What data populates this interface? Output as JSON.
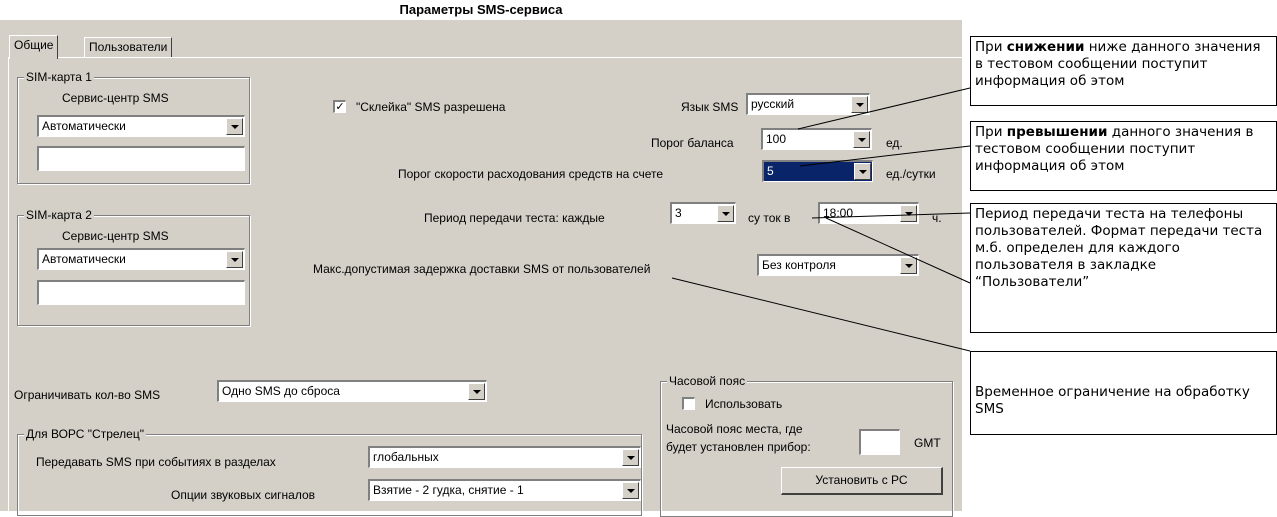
{
  "window": {
    "title": "Параметры SMS-сервиса"
  },
  "tabs": [
    {
      "label": "Общие",
      "active": true
    },
    {
      "label": "Пользователи",
      "active": false
    }
  ],
  "sim1": {
    "group_label": "SIM-карта 1",
    "center_label": "Сервис-центр SMS",
    "mode": "Автоматически",
    "number": ""
  },
  "sim2": {
    "group_label": "SIM-карта 2",
    "center_label": "Сервис-центр SMS",
    "mode": "Автоматически",
    "number": ""
  },
  "glue": {
    "label": "\"Склейка\" SMS разрешена",
    "checked": true,
    "mark": "✓"
  },
  "language": {
    "label": "Язык SMS",
    "value": "русский"
  },
  "balance": {
    "label": "Порог баланса",
    "value": "100",
    "unit": "ед."
  },
  "spend_rate": {
    "label": "Порог скорости расходования средств  на счете",
    "value": "5",
    "unit": "ед./сутки"
  },
  "test_period": {
    "label": "Период передачи теста: каждые",
    "days": "3",
    "days_unit": "су ток в",
    "time": "18:00",
    "time_unit": "ч."
  },
  "delay": {
    "label": "Макс.допустимая  задержка доставки SMS от пользователей",
    "value": "Без контроля"
  },
  "sms_limit": {
    "label": "Ограничивать кол-во SMS",
    "value": "Одно SMS до сброса"
  },
  "vors": {
    "group_label": "Для ВОРС \"Стрелец\"",
    "events_label": "Передавать SMS при  событиях в разделах",
    "events_value": "глобальных",
    "sound_label": "Опции звуковых сигналов",
    "sound_value": "Взятие - 2 гудка, снятие - 1"
  },
  "timezone": {
    "group_label": "Часовой пояс",
    "use_label": "Использовать",
    "place_label_1": "Часовой пояс места, где",
    "place_label_2": "будет установлен прибор:",
    "offset": "",
    "gmt": "GMT",
    "set_button": "Установить с РС"
  },
  "notes": {
    "balance": {
      "pre": "При ",
      "bold": "снижении",
      "post": " ниже данного значения в тестовом сообщении поступит информация об этом"
    },
    "rate": {
      "pre": "При ",
      "bold": "превышении",
      "post": " данного значения в тестовом сообщении поступит информация об этом"
    },
    "period": {
      "text": "Период передачи теста на телефоны пользователей. Формат передачи теста м.б. определен для каждого пользователя в закладке “Пользователи”"
    },
    "limit": {
      "text": "Временное ограничение на обработку SMS"
    }
  }
}
